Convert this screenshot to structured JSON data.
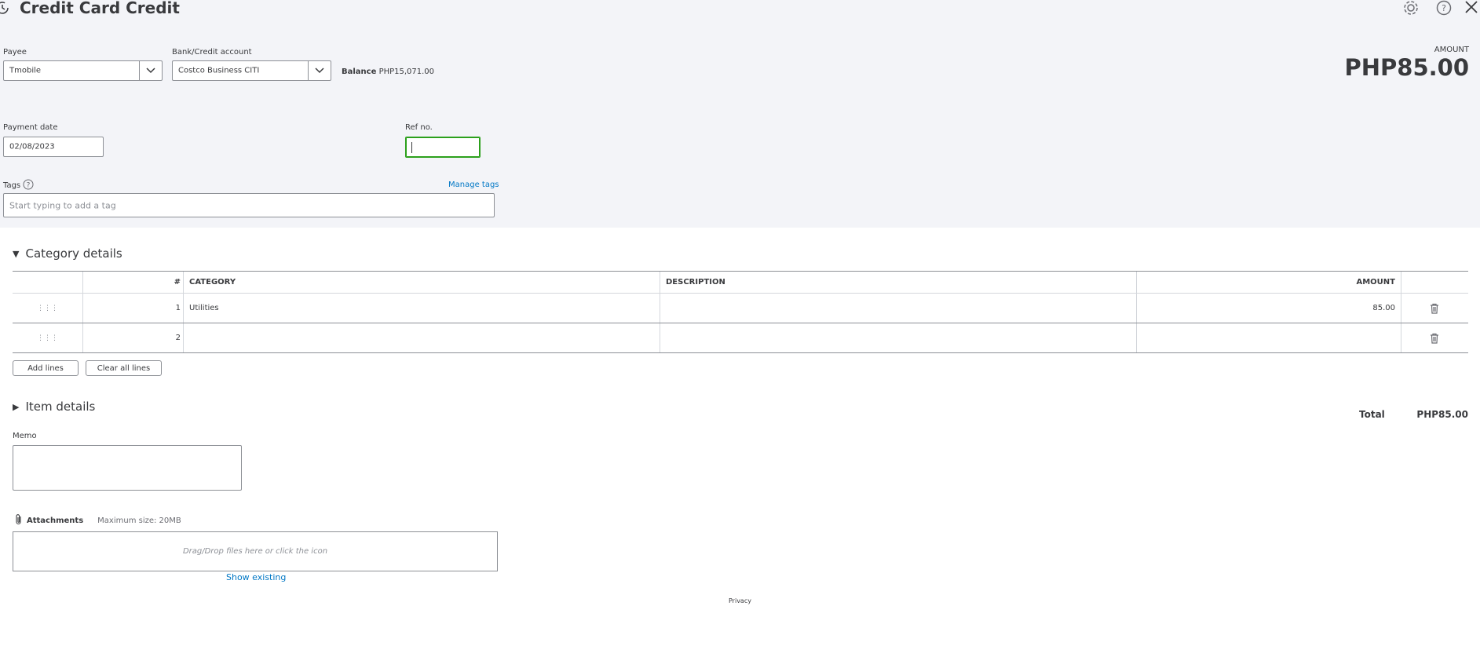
{
  "title": "Credit Card Credit",
  "header_icons": [
    "history-icon",
    "gear-icon",
    "help-icon",
    "close-icon"
  ],
  "amount_label": "AMOUNT",
  "amount_value": "PHP85.00",
  "payee": {
    "label": "Payee",
    "value": "Tmobile"
  },
  "bank_account": {
    "label": "Bank/Credit account",
    "value": "Costco Business CITI"
  },
  "balance": {
    "label": "Balance",
    "value": "PHP15,071.00"
  },
  "payment_date": {
    "label": "Payment date",
    "value": "02/08/2023"
  },
  "ref_no": {
    "label": "Ref no.",
    "value": ""
  },
  "tags": {
    "label": "Tags",
    "placeholder": "Start typing to add a tag",
    "manage_link": "Manage tags"
  },
  "category_details": {
    "title": "Category details",
    "columns": [
      "#",
      "CATEGORY",
      "DESCRIPTION",
      "AMOUNT"
    ],
    "rows": [
      {
        "num": "1",
        "category": "Utilities",
        "description": "",
        "amount": "85.00"
      },
      {
        "num": "2",
        "category": "",
        "description": "",
        "amount": ""
      }
    ],
    "add_lines": "Add lines",
    "clear_lines": "Clear all lines"
  },
  "item_details": {
    "title": "Item details"
  },
  "total": {
    "label": "Total",
    "value": "PHP85.00"
  },
  "memo": {
    "label": "Memo",
    "value": ""
  },
  "attachments": {
    "label": "Attachments",
    "max_size": "Maximum size: 20MB",
    "drop_text": "Drag/Drop files here or click the icon",
    "show_existing": "Show existing"
  },
  "footer": {
    "privacy": "Privacy"
  },
  "colors": {
    "accent_link": "#0077c5",
    "focus_green": "#2ca01c",
    "band_bg": "#f3f4f8"
  }
}
